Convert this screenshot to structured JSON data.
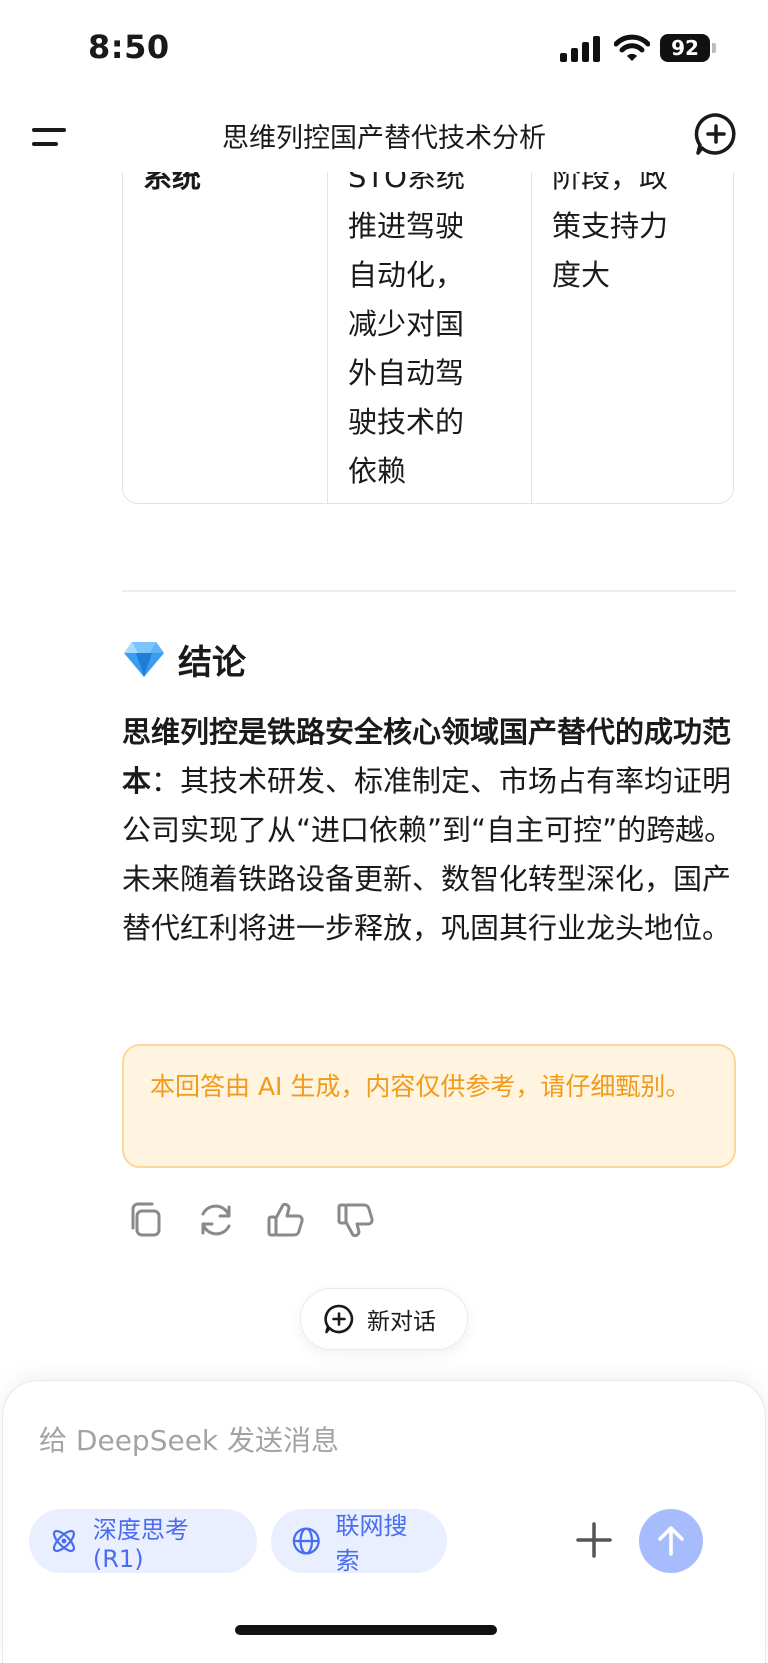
{
  "status_bar": {
    "time": "8:50",
    "battery": "92",
    "icons": [
      "signal-icon",
      "wifi-icon",
      "battery-icon"
    ]
  },
  "header": {
    "title": "思维列控国产替代技术分析",
    "menu_icon": "menu-icon",
    "new_chat_icon": "new-chat-icon"
  },
  "table_fragment": {
    "col1_lines": [
      "系统"
    ],
    "col2_lines": [
      "STO系统",
      "推进驾驶",
      "自动化，",
      "减少对国",
      "外自动驾",
      "驶技术的",
      "依赖"
    ],
    "col3_lines": [
      "阶段，政",
      "策支持力",
      "度大"
    ]
  },
  "conclusion": {
    "icon": "gem-icon",
    "heading": "结论",
    "bold_text": "思维列控是铁路安全核心领域国产替代的成功范本",
    "body_text": "：其技术研发、标准制定、市场占有率均证明公司实现了从“进口依赖”到“自主可控”的跨越。未来随着铁路设备更新、数智化转型深化，国产替代红利将进一步释放，巩固其行业龙头地位。"
  },
  "ai_notice": "本回答由 AI 生成，内容仅供参考，请仔细甄别。",
  "actions": [
    "copy-icon",
    "regenerate-icon",
    "thumbs-up-icon",
    "thumbs-down-icon"
  ],
  "new_chat_button": "新对话",
  "composer": {
    "placeholder": "给 DeepSeek 发送消息",
    "deep_think": "深度思考 (R1)",
    "web_search": "联网搜索"
  },
  "colors": {
    "accent": "#4a6cf0",
    "chip_bg": "#e9efff",
    "send_btn": "#a7bcfd",
    "notice_text": "#f29a1b",
    "notice_bg": "#fff4e0",
    "notice_border": "#fcd79a"
  }
}
